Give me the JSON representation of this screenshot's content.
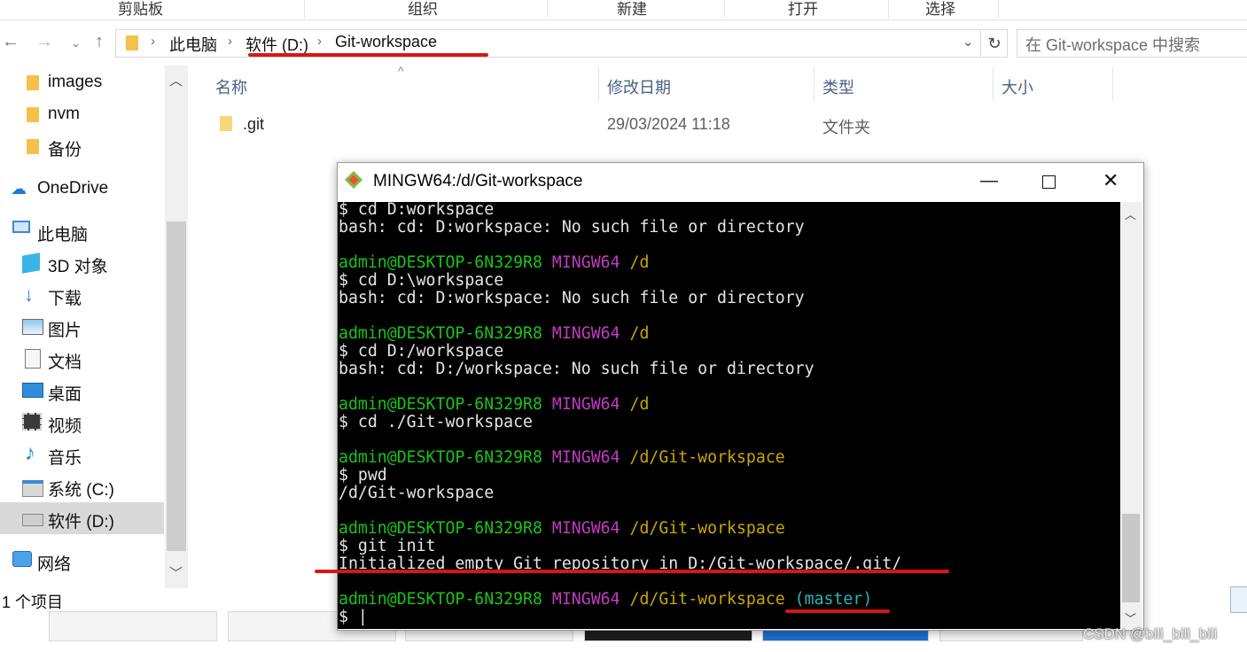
{
  "ribbon": {
    "groups": [
      "剪贴板",
      "组织",
      "新建",
      "打开",
      "选择"
    ]
  },
  "address": {
    "crumbs": [
      "此电脑",
      "软件 (D:)",
      "Git-workspace"
    ],
    "search_placeholder": "在 Git-workspace 中搜索"
  },
  "sidebar": {
    "items": [
      "images",
      "nvm",
      "备份",
      "OneDrive",
      "此电脑",
      "3D 对象",
      "下载",
      "图片",
      "文档",
      "桌面",
      "视频",
      "音乐",
      "系统 (C:)",
      "软件 (D:)",
      "网络"
    ],
    "selected": "软件 (D:)"
  },
  "columns": {
    "name": "名称",
    "modified": "修改日期",
    "type": "类型",
    "size": "大小"
  },
  "files": [
    {
      "name": ".git",
      "modified": "29/03/2024 11:18",
      "type": "文件夹",
      "size": ""
    }
  ],
  "status": {
    "count": "1 个项目"
  },
  "terminal": {
    "title": "MINGW64:/d/Git-workspace",
    "lines": [
      [
        {
          "t": "$ cd D:workspace",
          "c": "w"
        }
      ],
      [
        {
          "t": "bash: cd: D:workspace: No such file or directory",
          "c": "w"
        }
      ],
      [],
      [
        {
          "t": "admin@DESKTOP-6N329R8 ",
          "c": "g"
        },
        {
          "t": "MINGW64 ",
          "c": "m"
        },
        {
          "t": "/d",
          "c": "y"
        }
      ],
      [
        {
          "t": "$ cd D:\\workspace",
          "c": "w"
        }
      ],
      [
        {
          "t": "bash: cd: D:workspace: No such file or directory",
          "c": "w"
        }
      ],
      [],
      [
        {
          "t": "admin@DESKTOP-6N329R8 ",
          "c": "g"
        },
        {
          "t": "MINGW64 ",
          "c": "m"
        },
        {
          "t": "/d",
          "c": "y"
        }
      ],
      [
        {
          "t": "$ cd D:/workspace",
          "c": "w"
        }
      ],
      [
        {
          "t": "bash: cd: D:/workspace: No such file or directory",
          "c": "w"
        }
      ],
      [],
      [
        {
          "t": "admin@DESKTOP-6N329R8 ",
          "c": "g"
        },
        {
          "t": "MINGW64 ",
          "c": "m"
        },
        {
          "t": "/d",
          "c": "y"
        }
      ],
      [
        {
          "t": "$ cd ./Git-workspace",
          "c": "w"
        }
      ],
      [],
      [
        {
          "t": "admin@DESKTOP-6N329R8 ",
          "c": "g"
        },
        {
          "t": "MINGW64 ",
          "c": "m"
        },
        {
          "t": "/d/Git-workspace",
          "c": "y"
        }
      ],
      [
        {
          "t": "$ pwd",
          "c": "w"
        }
      ],
      [
        {
          "t": "/d/Git-workspace",
          "c": "w"
        }
      ],
      [],
      [
        {
          "t": "admin@DESKTOP-6N329R8 ",
          "c": "g"
        },
        {
          "t": "MINGW64 ",
          "c": "m"
        },
        {
          "t": "/d/Git-workspace",
          "c": "y"
        }
      ],
      [
        {
          "t": "$ git init",
          "c": "w"
        }
      ],
      [
        {
          "t": "Initialized empty Git repository in D:/Git-workspace/.git/",
          "c": "w"
        }
      ],
      [],
      [
        {
          "t": "admin@DESKTOP-6N329R8 ",
          "c": "g"
        },
        {
          "t": "MINGW64 ",
          "c": "m"
        },
        {
          "t": "/d/Git-workspace ",
          "c": "y"
        },
        {
          "t": "(master)",
          "c": "c"
        }
      ],
      [
        {
          "t": "$ ",
          "c": "w"
        },
        {
          "t": "|",
          "c": "w"
        }
      ]
    ]
  },
  "watermark": "CSDN @bili_bili_bili",
  "colors": {
    "prompt_user": "#18c418",
    "prompt_host": "#bf3cbf",
    "prompt_path": "#c7a800",
    "branch": "#2bb5b5",
    "annotation": "#d91515"
  }
}
